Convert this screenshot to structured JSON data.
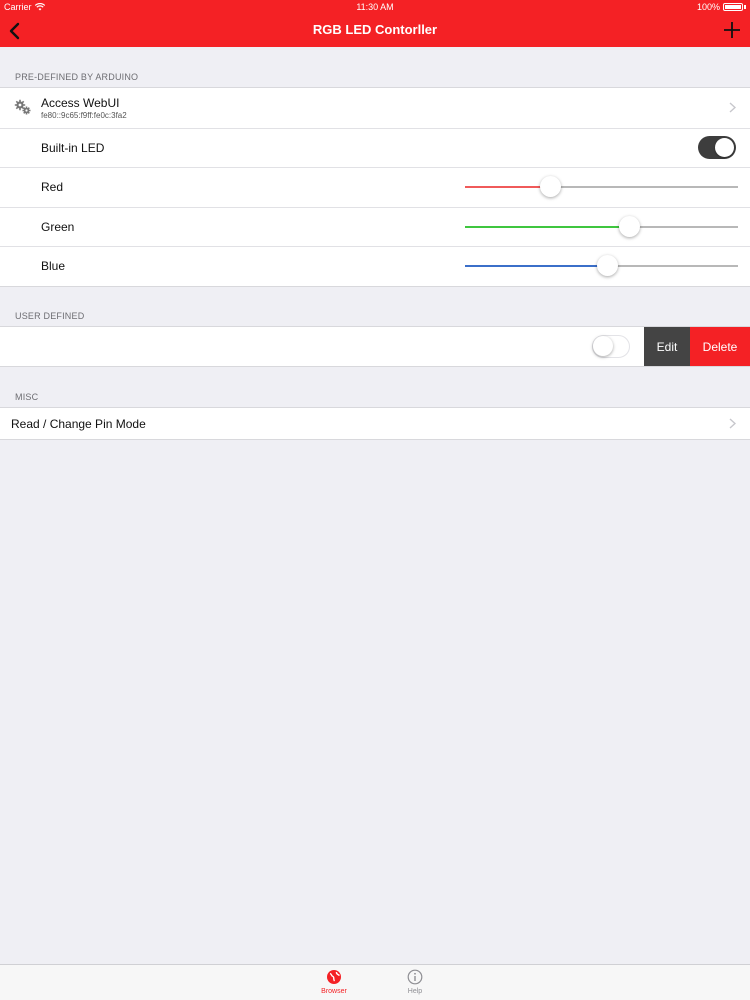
{
  "status": {
    "carrier": "Carrier",
    "time": "11:30 AM",
    "battery": "100%"
  },
  "nav": {
    "title": "RGB LED Contorller",
    "back_icon": "chevron-left-icon",
    "add_icon": "plus-icon"
  },
  "sections": {
    "predefined": {
      "header": "PRE-DEFINED BY ARDUINO",
      "webui": {
        "label": "Access WebUI",
        "address": "fe80::9c65:f9ff:fe0c:3fa2",
        "icon": "gears-icon"
      },
      "builtin_led": {
        "label": "Built-in LED",
        "on": true
      },
      "red": {
        "label": "Red",
        "value": 0.31,
        "color": "#f05a5a"
      },
      "green": {
        "label": "Green",
        "value": 0.6,
        "color": "#3fc63f"
      },
      "blue": {
        "label": "Blue",
        "value": 0.52,
        "color": "#3b6fc9"
      }
    },
    "user": {
      "header": "USER DEFINED",
      "toggle_on": false,
      "edit_label": "Edit",
      "delete_label": "Delete"
    },
    "misc": {
      "header": "MISC",
      "pin_mode_label": "Read / Change Pin Mode"
    }
  },
  "tabs": [
    {
      "label": "Browser",
      "icon": "globe-icon",
      "active": true
    },
    {
      "label": "Help",
      "icon": "info-icon",
      "active": false
    }
  ],
  "colors": {
    "brand_red": "#f42125",
    "edit_gray": "#444444"
  }
}
